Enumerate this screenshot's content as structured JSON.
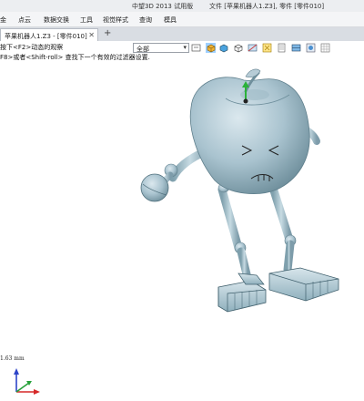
{
  "window": {
    "app_title": "中望3D 2013 试用版",
    "file_info": "文件 [苹果机器人1.Z3], 零件 [零件010]"
  },
  "menu": [
    {
      "label": "金"
    },
    {
      "label": "点云"
    },
    {
      "label": "数据交换"
    },
    {
      "label": "工具"
    },
    {
      "label": "视觉样式"
    },
    {
      "label": "查询"
    },
    {
      "label": "模具"
    }
  ],
  "tabs": [
    {
      "label": "苹果机器人1.Z3 - [零件010]",
      "close": "✕"
    }
  ],
  "tab_add": "+",
  "hints": {
    "line1": "按下<F2>动态的观察",
    "line2": "F8>或者<Shift-roll> 查找下一个有效的过滤器设置."
  },
  "filter": {
    "value": "全部",
    "arrow": "▾"
  },
  "toolbar_icons": [
    "filter-dropdown-icon",
    "shaded-cube-icon",
    "view-cube-icon",
    "wireframe-cube-icon",
    "section-view-icon",
    "zoom-fit-icon",
    "layers-icon",
    "hide-show-icon",
    "render-mode-icon",
    "grid-icon"
  ],
  "status": {
    "scale": "1.63 mm"
  },
  "colors": {
    "model": "#a9c3cf",
    "model_dark": "#6f8f9c",
    "accent_green": "#2bb23a",
    "axis_x": "#d62828",
    "axis_y": "#27a13a",
    "axis_z": "#2d44c8"
  }
}
